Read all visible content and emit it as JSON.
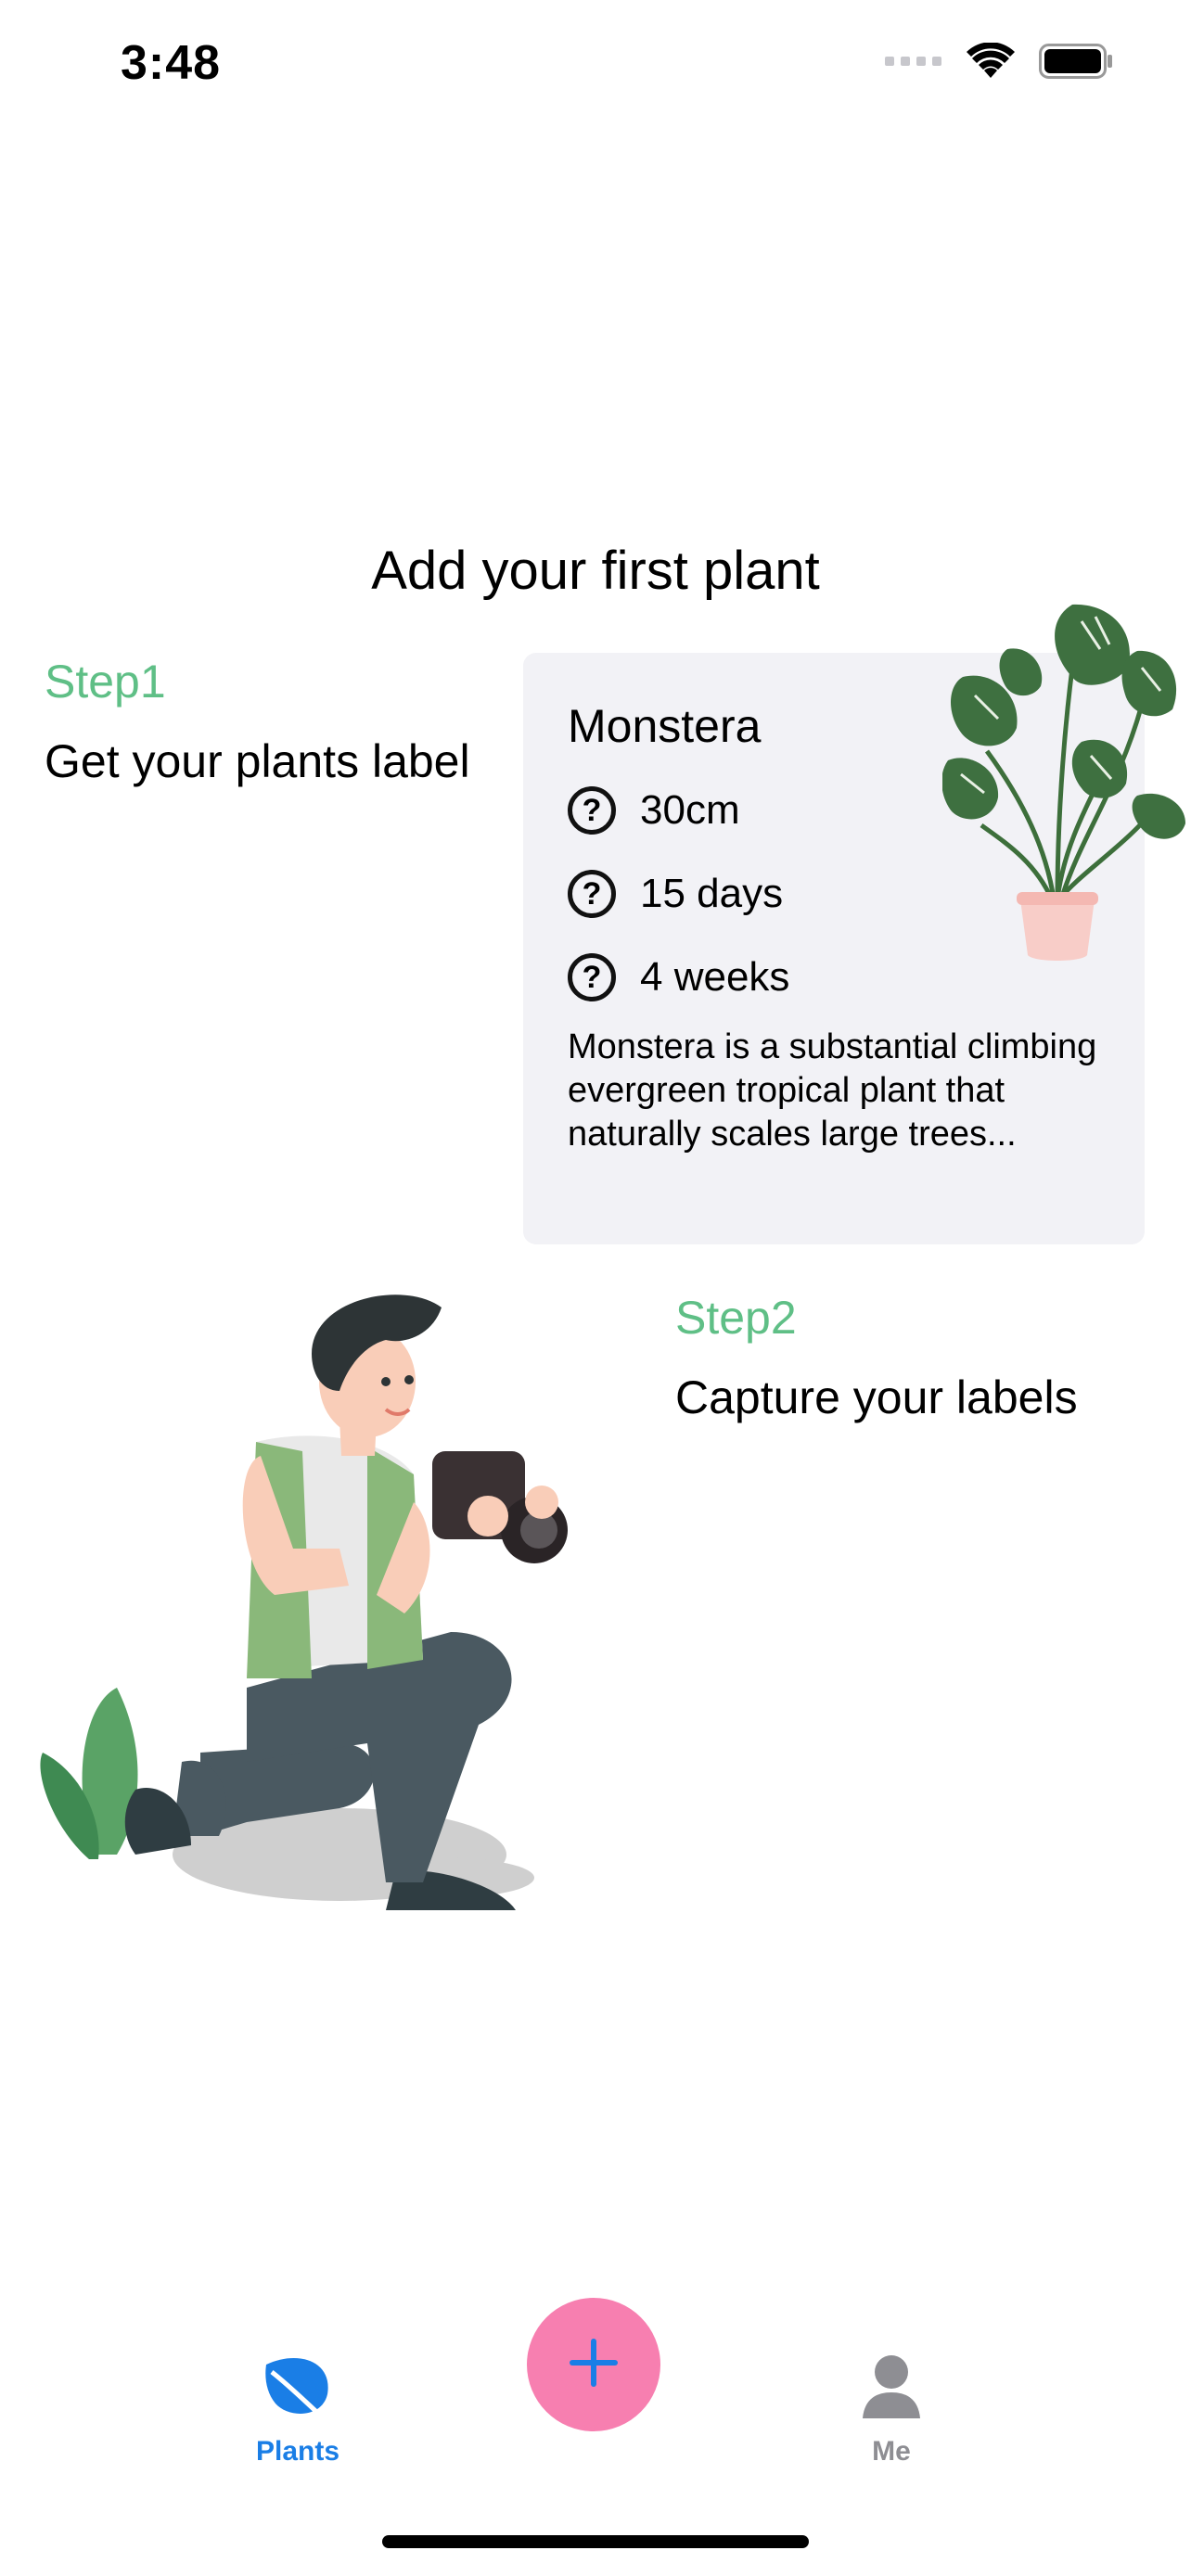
{
  "status_bar": {
    "time": "3:48"
  },
  "title": "Add your first plant",
  "step1": {
    "label": "Step1",
    "text": "Get your plants label"
  },
  "card": {
    "name": "Monstera",
    "rows": [
      {
        "icon": "question-circle-icon",
        "value": "30cm"
      },
      {
        "icon": "question-circle-icon",
        "value": "15 days"
      },
      {
        "icon": "question-circle-icon",
        "value": "4 weeks"
      }
    ],
    "description": "Monstera is a substantial climbing evergreen tropical plant that naturally scales large trees..."
  },
  "step2": {
    "label": "Step2",
    "text": "Capture your labels"
  },
  "tab_bar": {
    "tabs": [
      {
        "label": "Plants",
        "icon": "leaf-icon",
        "selected": true
      },
      {
        "label": "Me",
        "icon": "person-icon",
        "selected": false
      }
    ],
    "add_button_icon": "plus-icon"
  },
  "colors": {
    "accent_green": "#5fbf86",
    "tab_selected": "#1a7ee6",
    "tab_unselected": "#8e8e93",
    "fab": "#f77fb0",
    "card_bg": "#f2f2f6"
  }
}
